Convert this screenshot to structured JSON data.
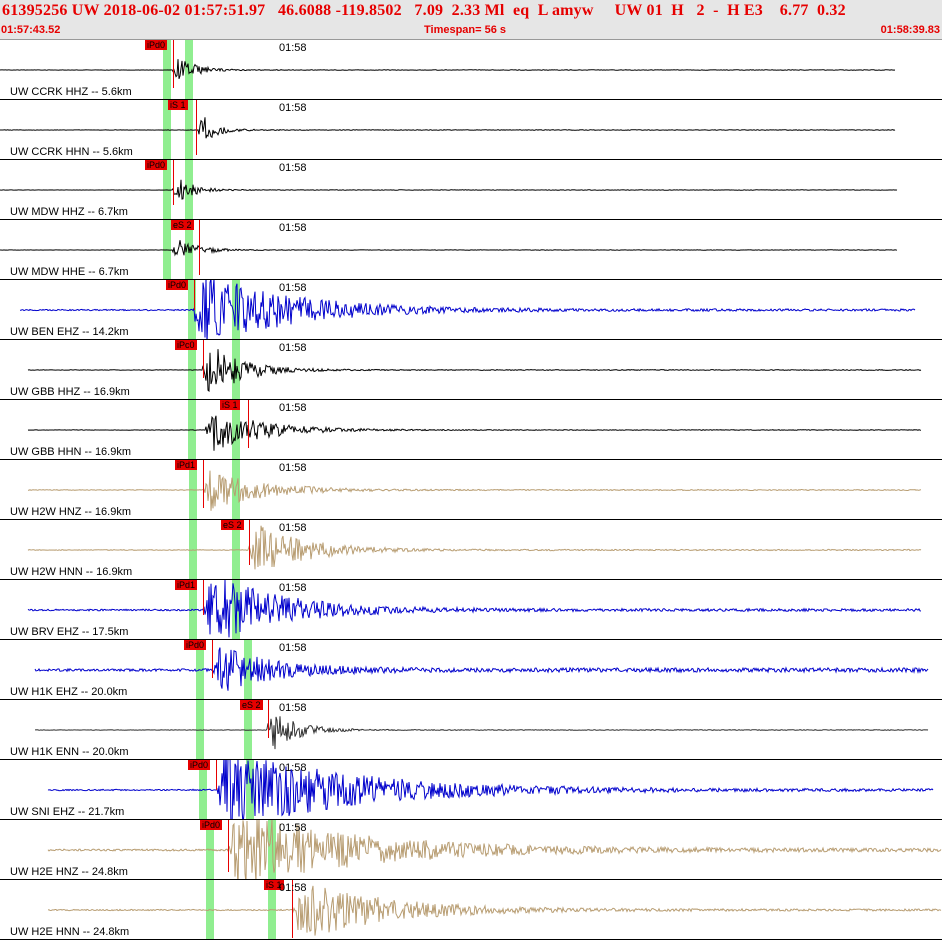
{
  "header": {
    "title": "61395256 UW 2018-06-02 01:57:51.97   46.6088 -119.8502   7.09  2.33 Ml  eq  L amyw     UW 01  H   2  -  H E3    6.77  0.32",
    "start_time": "01:57:43.52",
    "timespan": "Timespan=  56 s",
    "end_time": "01:58:39.83"
  },
  "panel_time_label": "01:58",
  "colors": {
    "header_bg": "#e6e6e6",
    "header_text": "#e60000",
    "pick": "#e60000",
    "green_band": "#90ee90",
    "trace_black": "#000000",
    "trace_blue": "#0000cc",
    "trace_tan": "#b89d72",
    "trace_dark": "#303030"
  },
  "traces": [
    {
      "label": "UW CCRK HHZ -- 5.6km",
      "pick": "iPd0",
      "color": "#000000",
      "amp": 0.75,
      "decay": 0.06,
      "base": 0.05
    },
    {
      "label": "UW CCRK HHN -- 5.6km",
      "pick": "iS 1",
      "color": "#000000",
      "amp": 0.85,
      "decay": 0.07,
      "base": 0.05
    },
    {
      "label": "UW MDW HHZ -- 6.7km",
      "pick": "iPd0",
      "color": "#000000",
      "amp": 0.65,
      "decay": 0.06,
      "base": 0.05
    },
    {
      "label": "UW MDW HHE -- 6.7km",
      "pick": "eS 2",
      "color": "#000000",
      "amp": 0.6,
      "decay": 0.05,
      "base": 0.05
    },
    {
      "label": "UW BEN EHZ -- 14.2km",
      "pick": "iPd0",
      "color": "#0000cc",
      "amp": 1.6,
      "decay": 0.012,
      "base": 0.1
    },
    {
      "label": "UW GBB HHZ -- 16.9km",
      "pick": "iPc0",
      "color": "#000000",
      "amp": 1.2,
      "decay": 0.03,
      "base": 0.05
    },
    {
      "label": "UW GBB HHN -- 16.9km",
      "pick": "iS 1",
      "color": "#000000",
      "amp": 0.9,
      "decay": 0.02,
      "base": 0.05
    },
    {
      "label": "UW H2W HNZ -- 16.9km",
      "pick": "iPd1",
      "color": "#b89d72",
      "amp": 0.9,
      "decay": 0.02,
      "base": 0.08
    },
    {
      "label": "UW H2W HNN -- 16.9km",
      "pick": "eS 2",
      "color": "#b89d72",
      "amp": 1.1,
      "decay": 0.02,
      "base": 0.08
    },
    {
      "label": "UW BRV EHZ -- 17.5km",
      "pick": "iPd1",
      "color": "#0000cc",
      "amp": 1.6,
      "decay": 0.015,
      "base": 0.12
    },
    {
      "label": "UW H1K EHZ -- 20.0km",
      "pick": "iPd0",
      "color": "#0000cc",
      "amp": 1.0,
      "decay": 0.02,
      "base": 0.3
    },
    {
      "label": "UW H1K ENN -- 20.0km",
      "pick": "eS 2",
      "color": "#303030",
      "amp": 1.0,
      "decay": 0.04,
      "base": 0.05
    },
    {
      "label": "UW SNI EHZ -- 21.7km",
      "pick": "iPd0",
      "color": "#0000cc",
      "amp": 1.6,
      "decay": 0.008,
      "base": 0.1
    },
    {
      "label": "UW H2E HNZ -- 24.8km",
      "pick": "iPd0",
      "color": "#b89d72",
      "amp": 1.5,
      "decay": 0.008,
      "base": 0.15
    },
    {
      "label": "UW H2E HNN -- 24.8km",
      "pick": "iS 1",
      "color": "#b89d72",
      "amp": 1.2,
      "decay": 0.012,
      "base": 0.12
    }
  ]
}
